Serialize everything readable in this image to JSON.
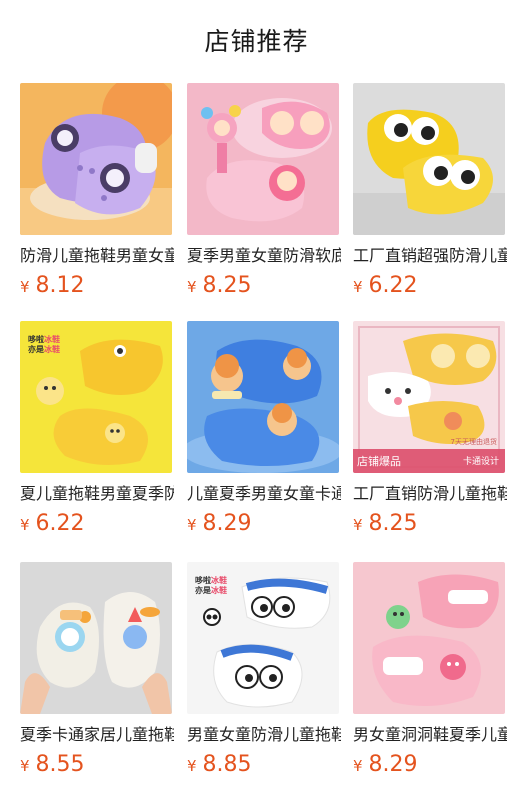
{
  "page": {
    "title": "店铺推荐"
  },
  "products": [
    {
      "name": "防滑儿童拖鞋男童女童",
      "currency": "¥",
      "price": "8.12",
      "bg": "#f4b65e",
      "accent": "#b79be6",
      "icon": "purple-kuromi-clog"
    },
    {
      "name": "夏季男童女童防滑软底",
      "currency": "¥",
      "price": "8.25",
      "bg": "#f3b8c8",
      "accent": "#f79fbd",
      "icon": "pink-princess-clog"
    },
    {
      "name": "工厂直销超强防滑儿童",
      "currency": "¥",
      "price": "6.22",
      "bg": "#dcdcdc",
      "accent": "#f5cf1e",
      "icon": "yellow-eyes-slide"
    },
    {
      "name": "夏儿童拖鞋男童夏季防滑",
      "currency": "¥",
      "price": "6.22",
      "bg": "#f5e53a",
      "accent": "#f7c62e",
      "icon": "yellow-dino-slide",
      "badge": {
        "line1": "哆啦",
        "line2": "亦是",
        "hl1": "冰鞋",
        "hl2": "冰鞋"
      }
    },
    {
      "name": "儿童夏季男童女童卡通",
      "currency": "¥",
      "price": "8.29",
      "bg": "#6ea8e6",
      "accent": "#3f7fe0",
      "icon": "blue-bear-clog"
    },
    {
      "name": "工厂直销防滑儿童拖鞋",
      "currency": "¥",
      "price": "8.25",
      "bg": "#f7dfe3",
      "accent": "#f6c84a",
      "icon": "yellow-deer-slipper",
      "overlay": {
        "left": "店铺爆品",
        "right": "卡通设计",
        "top": "7天无理由退货"
      }
    },
    {
      "name": "夏季卡通家居儿童拖鞋",
      "currency": "¥",
      "price": "8.55",
      "bg": "#d9d9d9",
      "accent": "#f2efe6",
      "icon": "white-rocket-clog"
    },
    {
      "name": "男童女童防滑儿童拖鞋",
      "currency": "¥",
      "price": "8.85",
      "bg": "#f5f5f5",
      "accent": "#3e77d6",
      "icon": "white-panda-slipper",
      "badge": {
        "line1": "哆啦",
        "line2": "亦是",
        "hl1": "冰鞋",
        "hl2": "冰鞋"
      }
    },
    {
      "name": "男女童洞洞鞋夏季儿童",
      "currency": "¥",
      "price": "8.29",
      "bg": "#f6c7cf",
      "accent": "#f7a3b7",
      "icon": "pink-dino-clog"
    }
  ]
}
